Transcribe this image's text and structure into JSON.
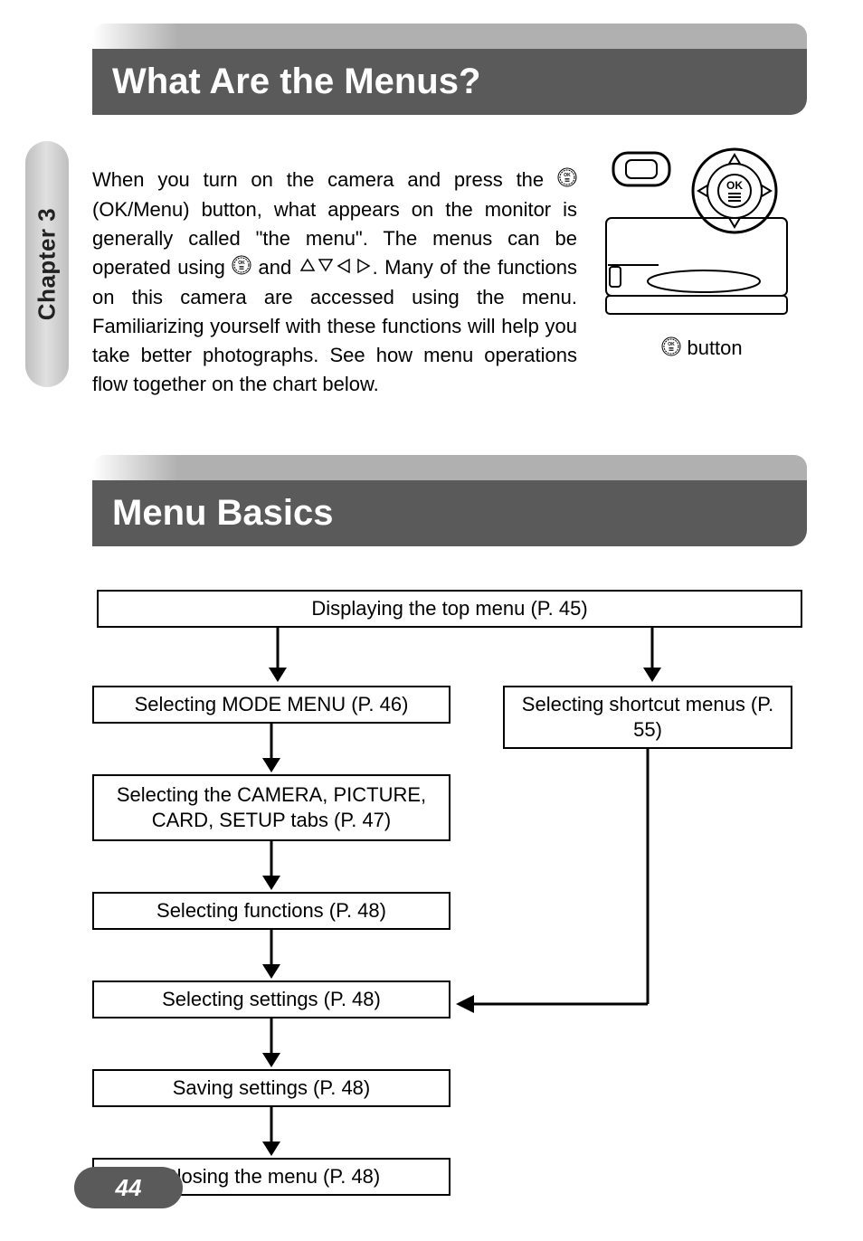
{
  "chapter_label": "Chapter 3",
  "heading1": "What Are the Menus?",
  "body": {
    "part1": "When you turn on the camera and press the ",
    "part2": " (OK/Menu) button, what appears on the monitor is generally called \"the menu\". The menus can be operated using ",
    "part3": " and ",
    "part4": ". Many of the functions on this camera are accessed using the menu. Familiarizing yourself with these functions will help you take better photographs. See how menu operations flow together on the chart below."
  },
  "cam_caption": " button",
  "heading2": "Menu Basics",
  "flow": {
    "top": "Displaying the top menu (P. 45)",
    "mode_menu": "Selecting MODE MENU (P. 46)",
    "shortcut": "Selecting shortcut menus (P. 55)",
    "tabs": "Selecting the CAMERA, PICTURE, CARD, SETUP tabs (P. 47)",
    "functions": "Selecting functions (P. 48)",
    "settings": "Selecting settings (P. 48)",
    "saving": "Saving settings (P. 48)",
    "closing": "Closing the menu (P. 48)"
  },
  "page_number": "44"
}
